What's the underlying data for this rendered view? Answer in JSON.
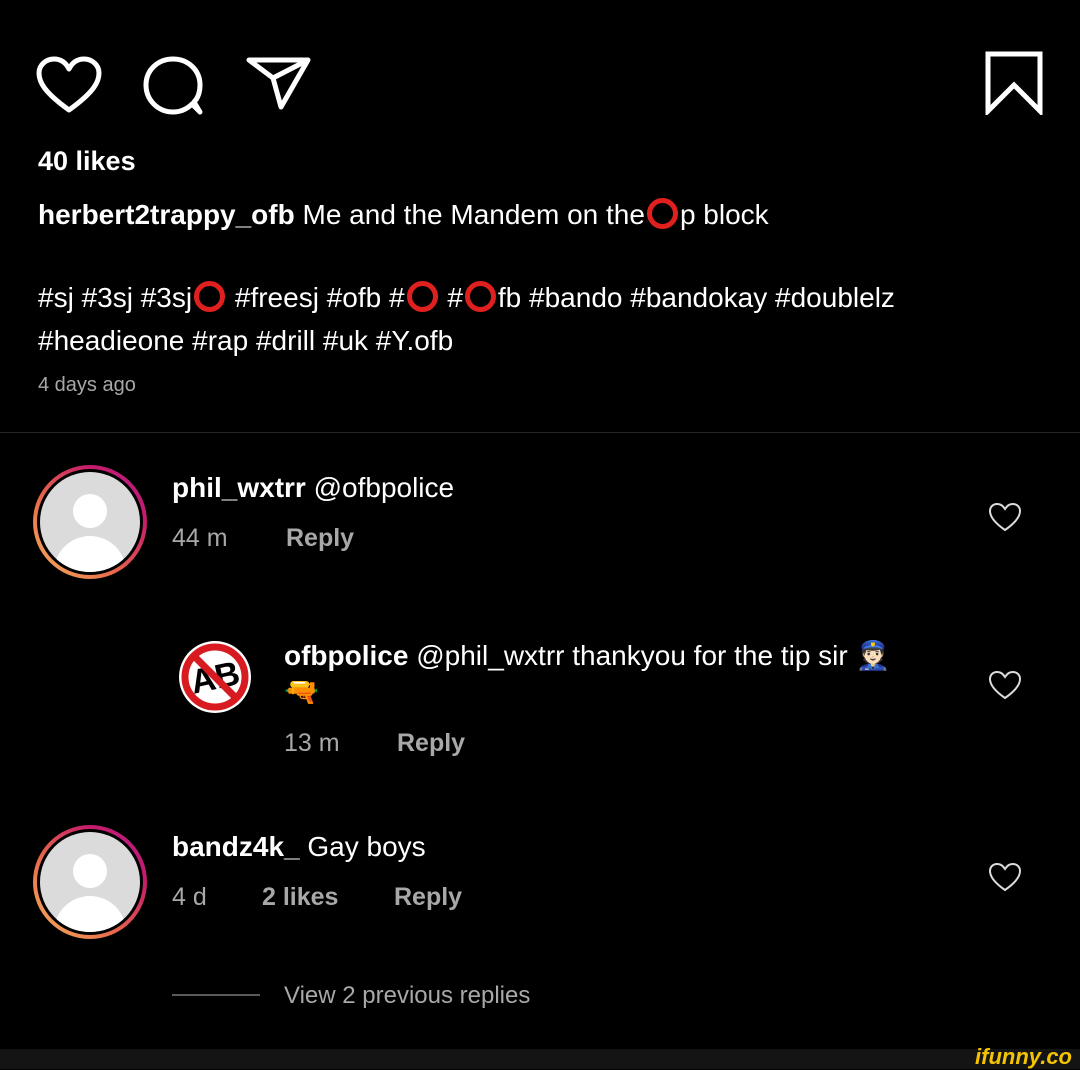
{
  "post": {
    "likes": "40 likes",
    "caption_user": "herbert2trappy_ofb",
    "caption_text_a": "Me and the Mandem on the",
    "caption_text_b": "p block",
    "tags_line1_a": "#sj #3sj #3sj",
    "tags_line1_b": "#freesj #ofb #",
    "tags_line1_c": "#",
    "tags_line1_d": "fb #bando #bandokay #doublelz",
    "tags_line2": "#headieone #rap #drill #uk #Y.ofb",
    "posted": "4 days ago"
  },
  "comments": [
    {
      "user": "phil_wxtrr",
      "text": "@ofbpolice",
      "time": "44 m",
      "reply": "Reply"
    },
    {
      "user": "ofbpolice",
      "text": "@phil_wxtrr thankyou for the tip sir 👮🏻",
      "text2": "🔫",
      "time": "13 m",
      "reply": "Reply"
    },
    {
      "user": "bandz4k_",
      "text": "Gay boys",
      "time": "4 d",
      "likes": "2 likes",
      "reply": "Reply"
    }
  ],
  "view_replies": "View 2 previous replies",
  "watermark": "ifunny.co",
  "colors": {
    "accent_red": "#e0201f",
    "muted": "#a8a8a8",
    "background": "#000000"
  }
}
